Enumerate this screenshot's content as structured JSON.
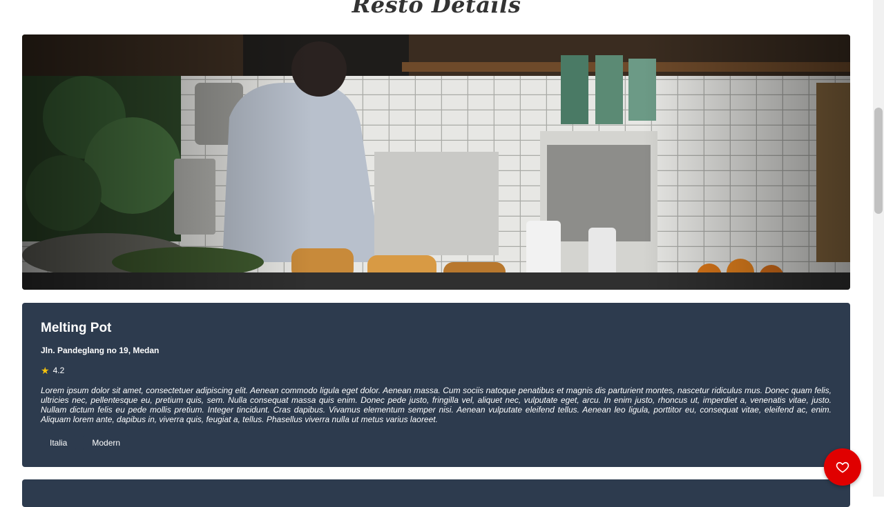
{
  "page": {
    "title": "Resto Details"
  },
  "hero": {
    "alt": "Restaurant interior with a barista behind the counter"
  },
  "resto": {
    "name": "Melting Pot",
    "address": "Jln. Pandeglang no 19, Medan",
    "rating": "4.2",
    "description": "Lorem ipsum dolor sit amet, consectetuer adipiscing elit. Aenean commodo ligula eget dolor. Aenean massa. Cum sociis natoque penatibus et magnis dis parturient montes, nascetur ridiculus mus. Donec quam felis, ultricies nec, pellentesque eu, pretium quis, sem. Nulla consequat massa quis enim. Donec pede justo, fringilla vel, aliquet nec, vulputate eget, arcu. In enim justo, rhoncus ut, imperdiet a, venenatis vitae, justo. Nullam dictum felis eu pede mollis pretium. Integer tincidunt. Cras dapibus. Vivamus elementum semper nisi. Aenean vulputate eleifend tellus. Aenean leo ligula, porttitor eu, consequat vitae, eleifend ac, enim. Aliquam lorem ante, dapibus in, viverra quis, feugiat a, tellus. Phasellus viverra nulla ut metus varius laoreet.",
    "categories": [
      "Italia",
      "Modern"
    ]
  },
  "icons": {
    "rating": "star-icon",
    "favorite": "heart-icon"
  },
  "colors": {
    "card_background": "#2d3b4e",
    "favorite_button": "#e00000",
    "star": "#f4c20d"
  }
}
